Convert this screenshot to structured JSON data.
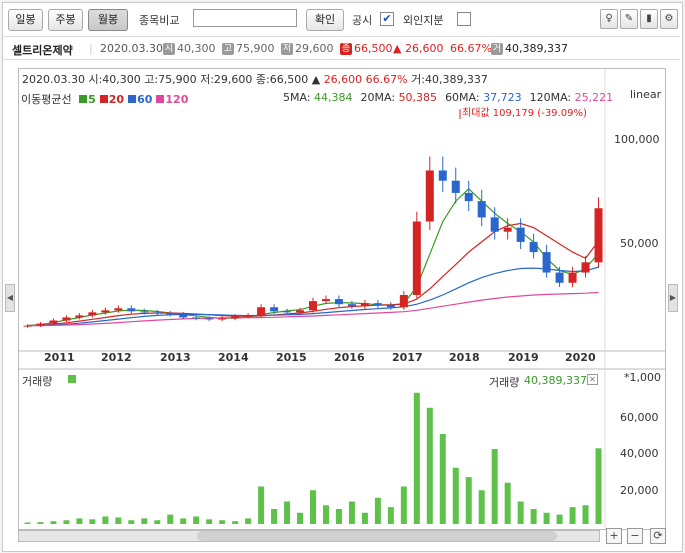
{
  "toolbar": {
    "daily_label": "일봉",
    "weekly_label": "주봉",
    "monthly_label": "월봉",
    "compare_label": "종목비교",
    "compare_placeholder": "",
    "confirm_label": "확인",
    "disclosure_label": "공시",
    "disclosure_checked": "✔",
    "foreign_label": "외인지분"
  },
  "info": {
    "name": "셀트리온제약",
    "date": "2020.03.30",
    "open_tag": "시",
    "open": "40,300",
    "high_tag": "고",
    "high": "75,900",
    "low_tag": "저",
    "low": "29,600",
    "close_tag": "종",
    "close": "66,500",
    "change": "▲ 26,600",
    "change_pct": "66.67%",
    "vol_tag": "거",
    "volume": "40,389,337"
  },
  "chart": {
    "header_line": "2020.03.30 시:40,300 고:75,900 저:29,600 종:66,500 ▲",
    "header_change": "26,600 66.67%",
    "header_vol": "거:40,389,337",
    "ma_title": "이동평균선",
    "ma_items": [
      {
        "label": "5",
        "color": "#3a9a27"
      },
      {
        "label": "20",
        "color": "#d42424"
      },
      {
        "label": "60",
        "color": "#2a66cc"
      },
      {
        "label": "120",
        "color": "#e0489b"
      }
    ],
    "ma_values": [
      {
        "label": "5MA:",
        "value": "44,384",
        "color": "#3a9a27"
      },
      {
        "label": "20MA:",
        "value": "50,385",
        "color": "#d42424"
      },
      {
        "label": "60MA:",
        "value": "37,723",
        "color": "#2a66cc"
      },
      {
        "label": "120MA:",
        "value": "25,221",
        "color": "#e0489b"
      }
    ],
    "scale_label": "linear",
    "max_note": "최대값 109,179 (-39.09%)",
    "yticks": [
      "100,000",
      "50,000"
    ],
    "xticks": [
      "2011",
      "2012",
      "2013",
      "2014",
      "2015",
      "2016",
      "2017",
      "2018",
      "2019",
      "2020"
    ],
    "volume_label": "거래량",
    "volume_value": "40,389,337",
    "volume_unit": "*1,000",
    "vol_yticks": [
      "60,000",
      "40,000",
      "20,000"
    ]
  },
  "chart_data": {
    "type": "candlestick",
    "x": [
      "2010-09",
      "2010-12",
      "2011-03",
      "2011-06",
      "2011-09",
      "2011-12",
      "2012-03",
      "2012-06",
      "2012-09",
      "2012-12",
      "2013-03",
      "2013-06",
      "2013-09",
      "2013-12",
      "2014-03",
      "2014-06",
      "2014-09",
      "2014-12",
      "2015-03",
      "2015-06",
      "2015-09",
      "2015-12",
      "2016-03",
      "2016-06",
      "2016-09",
      "2016-12",
      "2017-03",
      "2017-06",
      "2017-09",
      "2017-12",
      "2018-01",
      "2018-02",
      "2018-03",
      "2018-05",
      "2018-07",
      "2018-09",
      "2018-11",
      "2019-01",
      "2019-03",
      "2019-05",
      "2019-07",
      "2019-09",
      "2019-11",
      "2020-01",
      "2020-03"
    ],
    "close": [
      9000,
      10000,
      11500,
      13000,
      14000,
      15500,
      16500,
      17500,
      16000,
      15500,
      15000,
      14500,
      13000,
      12500,
      12000,
      12500,
      13500,
      14000,
      18000,
      16000,
      15500,
      16500,
      21000,
      22000,
      19500,
      18500,
      20000,
      19000,
      18000,
      24000,
      60000,
      85000,
      80000,
      74000,
      70000,
      62000,
      55000,
      57000,
      50000,
      45000,
      35000,
      30000,
      35000,
      40000,
      66500
    ],
    "ma_series": [
      {
        "name": "5",
        "values": [
          9000,
          9500,
          10500,
          11800,
          13000,
          14200,
          15200,
          16200,
          16600,
          16400,
          15900,
          15200,
          14400,
          13800,
          13000,
          12600,
          12700,
          13100,
          14500,
          15400,
          16200,
          16800,
          18500,
          19900,
          20300,
          20100,
          19800,
          19200,
          19100,
          19800,
          28000,
          44000,
          60000,
          70000,
          76000,
          70000,
          64000,
          59000,
          55000,
          50000,
          42000,
          36000,
          34000,
          37000,
          44384
        ]
      },
      {
        "name": "20",
        "values": [
          9000,
          9200,
          9700,
          10400,
          11200,
          12100,
          13000,
          13900,
          14600,
          15000,
          15200,
          15200,
          15000,
          14700,
          14300,
          13900,
          13600,
          13500,
          13800,
          14200,
          14700,
          15200,
          16000,
          17000,
          17800,
          18300,
          18700,
          19000,
          19200,
          19500,
          22000,
          27000,
          33000,
          39000,
          45000,
          50000,
          55000,
          58000,
          59000,
          57000,
          53000,
          49000,
          45000,
          42000,
          50385
        ]
      },
      {
        "name": "60",
        "values": [
          9000,
          9100,
          9300,
          9700,
          10200,
          10800,
          11500,
          12200,
          12900,
          13500,
          14000,
          14300,
          14500,
          14500,
          14400,
          14200,
          14000,
          13900,
          14000,
          14100,
          14300,
          14500,
          14900,
          15400,
          15900,
          16400,
          16900,
          17300,
          17700,
          18200,
          19500,
          21500,
          24000,
          27000,
          30000,
          32500,
          34500,
          36000,
          37000,
          37200,
          36800,
          36000,
          35500,
          35800,
          37723
        ]
      },
      {
        "name": "120",
        "values": [
          9000,
          9000,
          9100,
          9300,
          9500,
          9800,
          10100,
          10500,
          10900,
          11300,
          11700,
          12000,
          12300,
          12500,
          12700,
          12800,
          12800,
          12900,
          13000,
          13100,
          13300,
          13500,
          13700,
          14000,
          14300,
          14600,
          14900,
          15200,
          15500,
          15800,
          16500,
          17500,
          18500,
          19500,
          20500,
          21500,
          22300,
          23000,
          23500,
          24000,
          24300,
          24500,
          24700,
          24900,
          25221
        ]
      }
    ],
    "volume_k": [
      800,
      1000,
      1500,
      2000,
      3000,
      2500,
      4000,
      3500,
      2000,
      3000,
      2000,
      5000,
      3000,
      4000,
      2500,
      2000,
      1500,
      3000,
      20000,
      8000,
      12000,
      6000,
      18000,
      10000,
      8000,
      12000,
      6000,
      14000,
      9000,
      20000,
      70000,
      62000,
      48000,
      30000,
      25000,
      18000,
      40000,
      22000,
      12000,
      8000,
      6000,
      5000,
      9000,
      10000,
      40389
    ],
    "ylim": [
      0,
      120000
    ],
    "vol_ylim": [
      0,
      80000
    ]
  }
}
